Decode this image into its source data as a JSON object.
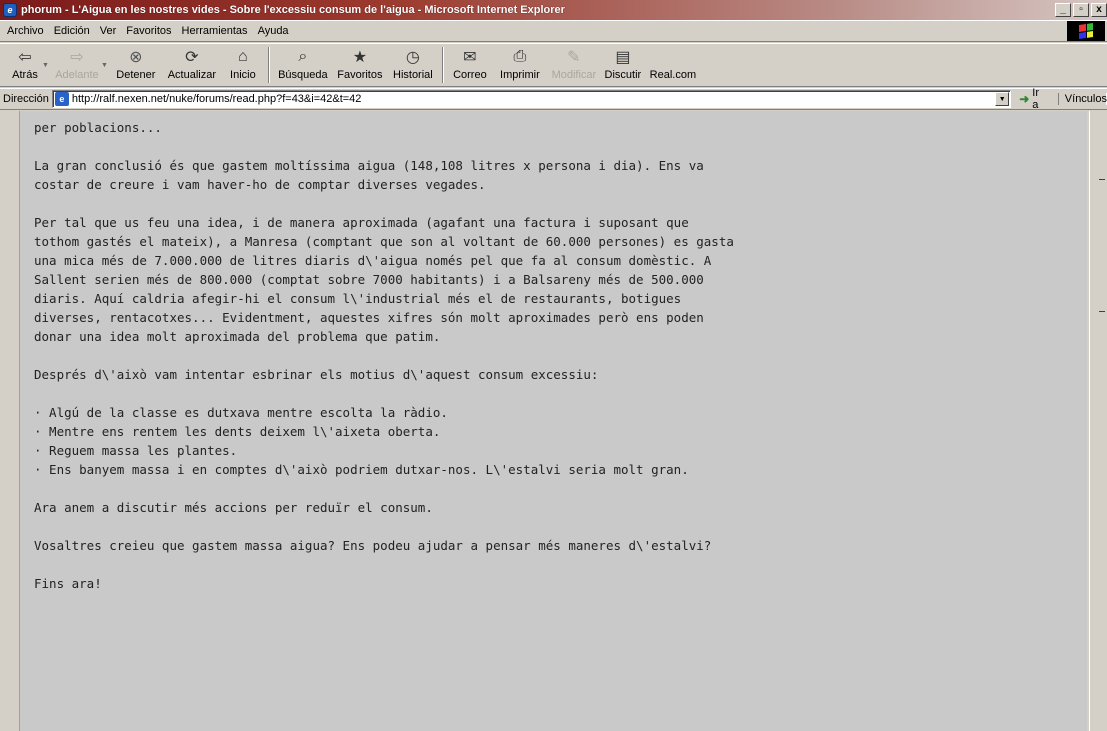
{
  "window": {
    "title": "phorum - L'Aigua en les nostres vides - Sobre l'excessiu consum de l'aigua - Microsoft Internet Explorer",
    "minimize": "_",
    "maximize": "ȸ",
    "close": "x"
  },
  "menu": [
    "Archivo",
    "Edición",
    "Ver",
    "Favoritos",
    "Herramientas",
    "Ayuda"
  ],
  "toolbar": {
    "back": "Atrás",
    "forward": "Adelante",
    "stop": "Detener",
    "refresh": "Actualizar",
    "home": "Inicio",
    "search": "Búsqueda",
    "favorites": "Favoritos",
    "history": "Historial",
    "mail": "Correo",
    "print": "Imprimir",
    "edit": "Modificar",
    "discuss": "Discutir",
    "realcom": "Real.com"
  },
  "address": {
    "label": "Dirección",
    "url": "http://ralf.nexen.net/nuke/forums/read.php?f=43&i=42&t=42",
    "go": "Ir a",
    "links": "Vínculos"
  },
  "post": {
    "line0": "per poblacions...",
    "p1": "La gran conclusió és que gastem moltíssima aigua (148,108 litres x persona i dia). Ens va\ncostar de creure i vam haver-ho de comptar diverses vegades.",
    "p2": "Per tal que us feu una idea, i de manera aproximada (agafant una factura i suposant que\ntothom gastés el mateix), a Manresa (comptant que son al voltant de 60.000 persones) es gasta\nuna mica més de 7.000.000 de litres diaris d\\'aigua només pel que fa al consum domèstic. A\nSallent serien més de 800.000 (comptat sobre 7000 habitants) i a Balsareny més de 500.000\ndiaris. Aquí caldria afegir-hi el consum l\\'industrial més el de restaurants, botigues\ndiverses, rentacotxes... Evidentment, aquestes xifres són molt aproximades però ens poden\ndonar una idea molt aproximada del problema que patim.",
    "p3": "Després d\\'això vam intentar esbrinar els motius d\\'aquest consum excessiu:",
    "bullets": [
      "· Algú de la classe es dutxava mentre escolta la ràdio.",
      "· Mentre ens rentem les dents deixem l\\'aixeta oberta.",
      "· Reguem massa les plantes.",
      "· Ens banyem massa i en comptes d\\'això podriem dutxar-nos. L\\'estalvi seria molt gran."
    ],
    "p4": "Ara anem a discutir més accions per reduïr el consum.",
    "p5": "Vosaltres creieu que gastem massa aigua? Ens podeu ajudar a pensar més maneres d\\'estalvi?",
    "p6": "Fins ara!"
  }
}
